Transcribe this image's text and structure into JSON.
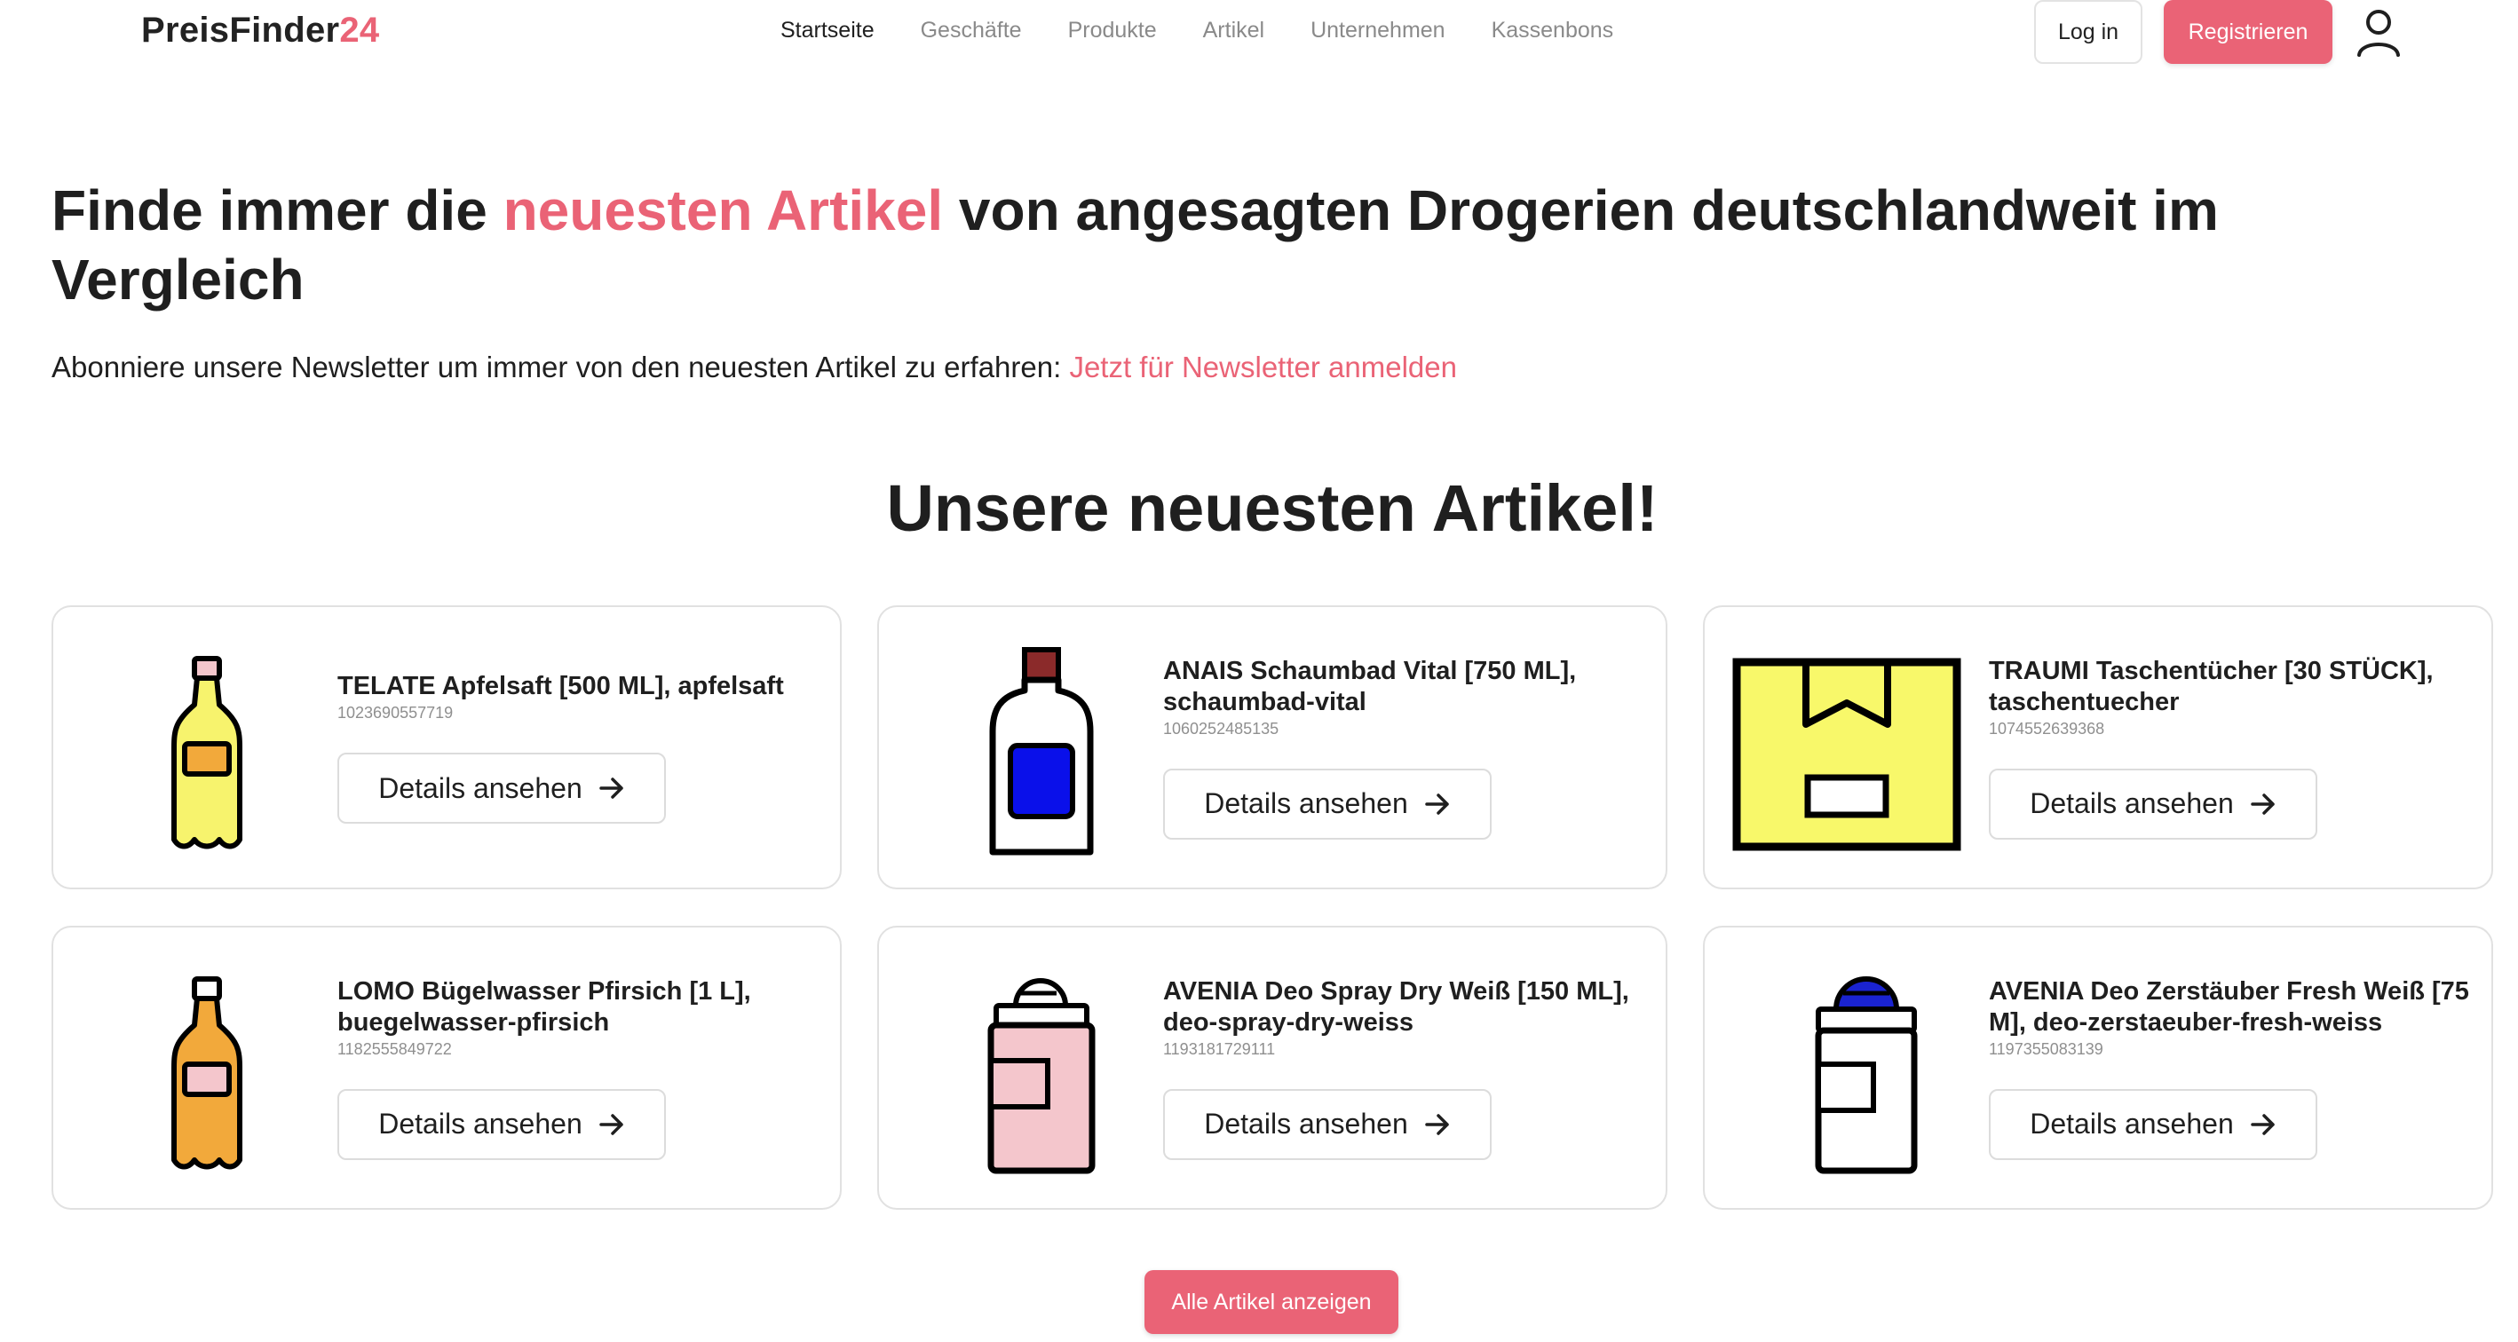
{
  "header": {
    "logo_main": "PreisFinder",
    "logo_accent": "24",
    "nav": [
      {
        "label": "Startseite",
        "active": true
      },
      {
        "label": "Geschäfte",
        "active": false
      },
      {
        "label": "Produkte",
        "active": false
      },
      {
        "label": "Artikel",
        "active": false
      },
      {
        "label": "Unternehmen",
        "active": false
      },
      {
        "label": "Kassenbons",
        "active": false
      }
    ],
    "login_label": "Log in",
    "register_label": "Registrieren",
    "user_icon": "user-icon"
  },
  "hero": {
    "title_part1": "Finde immer die ",
    "title_accent": "neuesten Artikel",
    "title_part2": " von angesagten Drogerien deutschlandweit im Vergleich",
    "subtitle": "Abonniere unsere Newsletter um immer von den neuesten Artikel zu erfahren: ",
    "newsletter_link": "Jetzt für Newsletter anmelden"
  },
  "section_title": "Unsere neuesten Artikel!",
  "products": [
    {
      "name": "TELATE Apfelsaft [500 ML], apfelsaft",
      "ean": "1023690557719",
      "icon": "yellow-bottle-icon"
    },
    {
      "name": "ANAIS Schaumbad Vital [750 ML], schaumbad-vital",
      "ean": "1060252485135",
      "icon": "bath-bottle-icon"
    },
    {
      "name": "TRAUMI Taschentücher [30 STÜCK], taschentuecher",
      "ean": "1074552639368",
      "icon": "box-icon"
    },
    {
      "name": "LOMO Bügelwasser Pfirsich [1 L], buegelwasser-pfirsich",
      "ean": "1182555849722",
      "icon": "orange-bottle-icon"
    },
    {
      "name": "AVENIA Deo Spray Dry Weiß [150 ML], deo-spray-dry-weiss",
      "ean": "1193181729111",
      "icon": "spray-can-icon"
    },
    {
      "name": "AVENIA Deo Zerstäuber Fresh Weiß [75 M], deo-zerstaeuber-fresh-weiss",
      "ean": "1197355083139",
      "icon": "roll-on-icon"
    }
  ],
  "details_label": "Details ansehen",
  "all_articles_label": "Alle Artikel anzeigen",
  "colors": {
    "accent": "#ea6376",
    "bottle_yellow": "#f7f36d",
    "bottle_orange": "#f2a93b",
    "bath_blue": "#0a10ea",
    "cap_red": "#8b2a2a",
    "box_yellow": "#f8f86a",
    "spray_pink": "#f4c6cc",
    "rollon_blue": "#1a23d0"
  }
}
